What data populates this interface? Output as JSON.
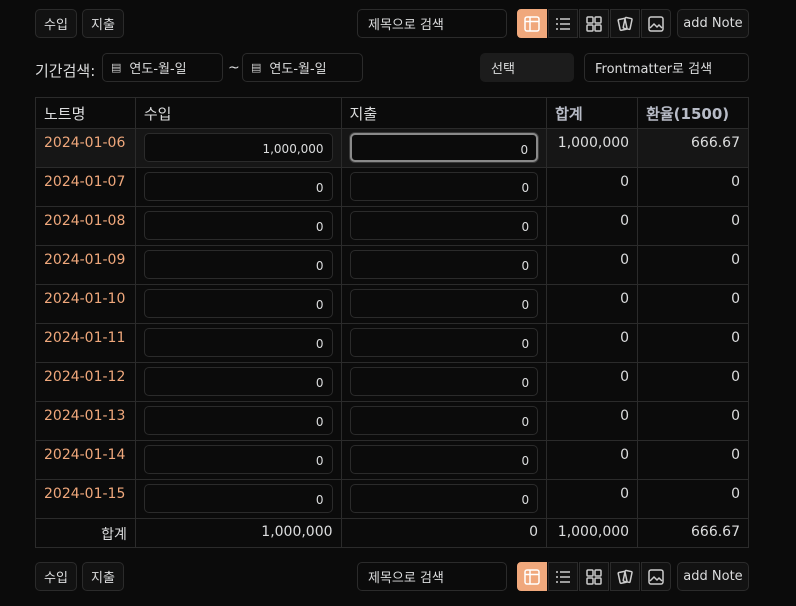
{
  "toolbar_top": {
    "income_label": "수입",
    "expense_label": "지출",
    "search_placeholder": "제목으로 검색",
    "add_note_label": "add Note"
  },
  "toolbar_bottom": {
    "income_label": "수입",
    "expense_label": "지출",
    "search_placeholder": "제목으로 검색",
    "add_note_label": "add Note"
  },
  "filters": {
    "period_label": "기간검색:",
    "date_placeholder": "연도-월-일",
    "separator": "~",
    "select_value": "선택",
    "frontmatter_placeholder": "Frontmatter로 검색"
  },
  "table": {
    "headers": [
      "노트명",
      "수입",
      "지출",
      "합계",
      "환율(1500)"
    ],
    "rows": [
      {
        "date": "2024-01-06",
        "income": "1,000,000",
        "expense": "0",
        "sum": "1,000,000",
        "rate": "666.67"
      },
      {
        "date": "2024-01-07",
        "income": "0",
        "expense": "0",
        "sum": "0",
        "rate": "0"
      },
      {
        "date": "2024-01-08",
        "income": "0",
        "expense": "0",
        "sum": "0",
        "rate": "0"
      },
      {
        "date": "2024-01-09",
        "income": "0",
        "expense": "0",
        "sum": "0",
        "rate": "0"
      },
      {
        "date": "2024-01-10",
        "income": "0",
        "expense": "0",
        "sum": "0",
        "rate": "0"
      },
      {
        "date": "2024-01-11",
        "income": "0",
        "expense": "0",
        "sum": "0",
        "rate": "0"
      },
      {
        "date": "2024-01-12",
        "income": "0",
        "expense": "0",
        "sum": "0",
        "rate": "0"
      },
      {
        "date": "2024-01-13",
        "income": "0",
        "expense": "0",
        "sum": "0",
        "rate": "0"
      },
      {
        "date": "2024-01-14",
        "income": "0",
        "expense": "0",
        "sum": "0",
        "rate": "0"
      },
      {
        "date": "2024-01-15",
        "income": "0",
        "expense": "0",
        "sum": "0",
        "rate": "0"
      }
    ],
    "total": {
      "label": "합계",
      "income": "1,000,000",
      "expense": "0",
      "sum": "1,000,000",
      "rate": "666.67"
    }
  },
  "view_icons": [
    "table-icon",
    "list-icon",
    "grid-icon",
    "cards-icon",
    "gallery-icon"
  ],
  "colors": {
    "accent": "#f0a87c",
    "background": "#0b0b0b",
    "border": "#2b2b2b"
  }
}
